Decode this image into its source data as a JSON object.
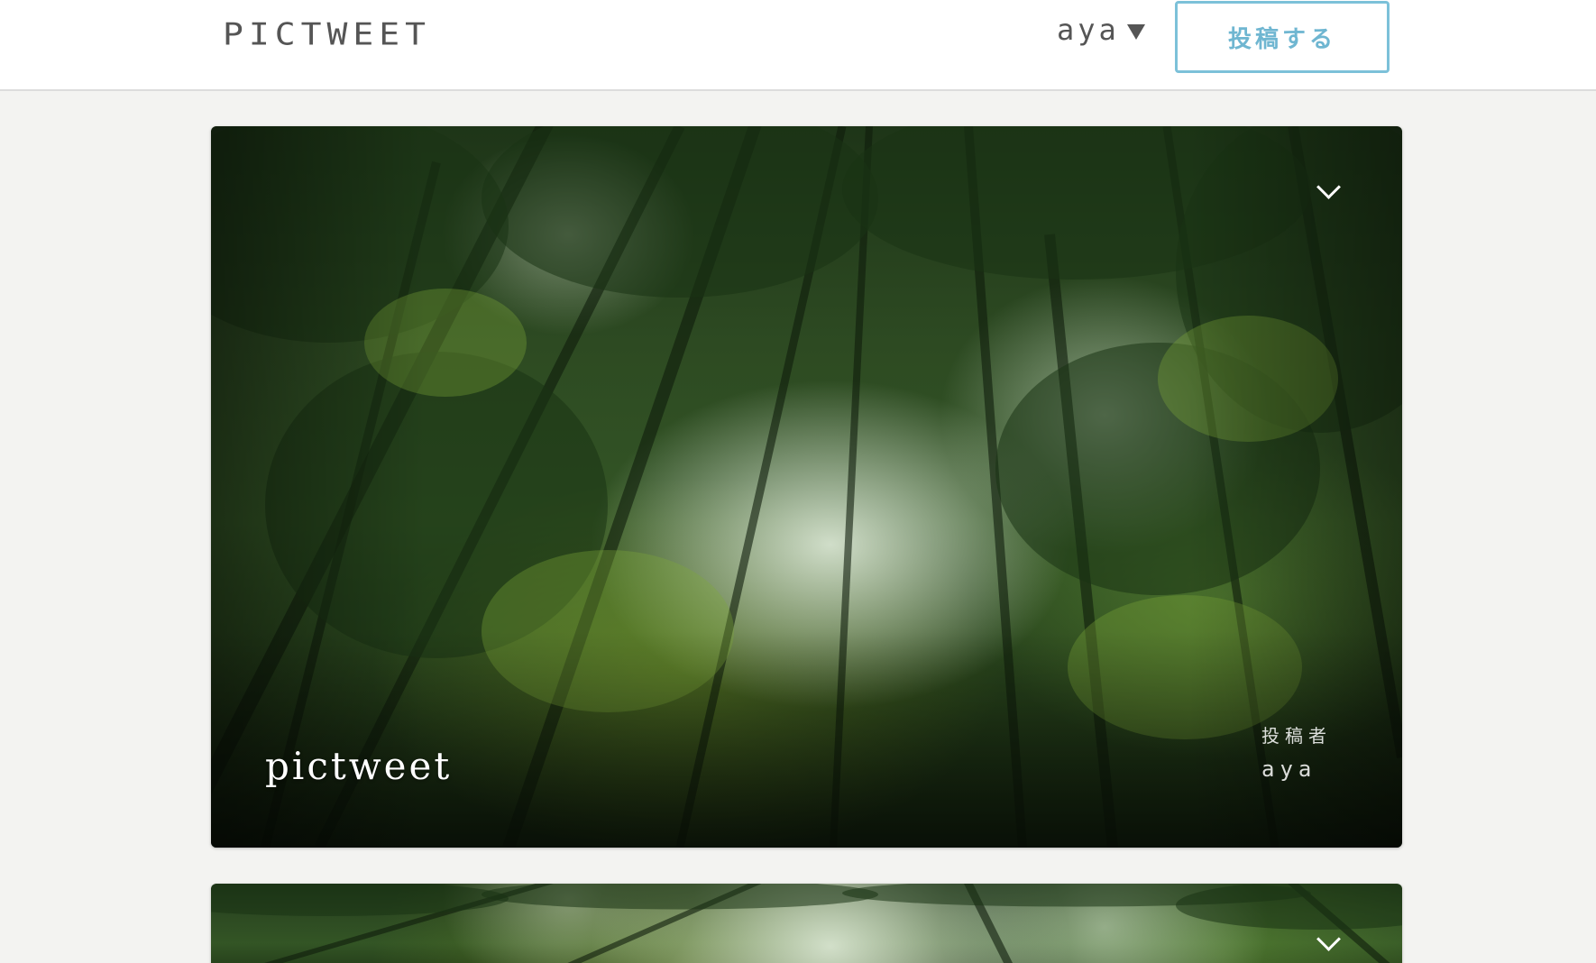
{
  "header": {
    "logo": "pictweet",
    "user_name": "aya",
    "post_button_label": "投稿する"
  },
  "colors": {
    "accent": "#7cc1d9",
    "page_background": "#f3f3f1",
    "header_background": "#ffffff"
  },
  "posts": [
    {
      "text": "pictweet",
      "author_label": "投稿者",
      "author_name": "aya",
      "image": "forest-canopy-photo"
    },
    {
      "image": "forest-canopy-photo"
    }
  ]
}
